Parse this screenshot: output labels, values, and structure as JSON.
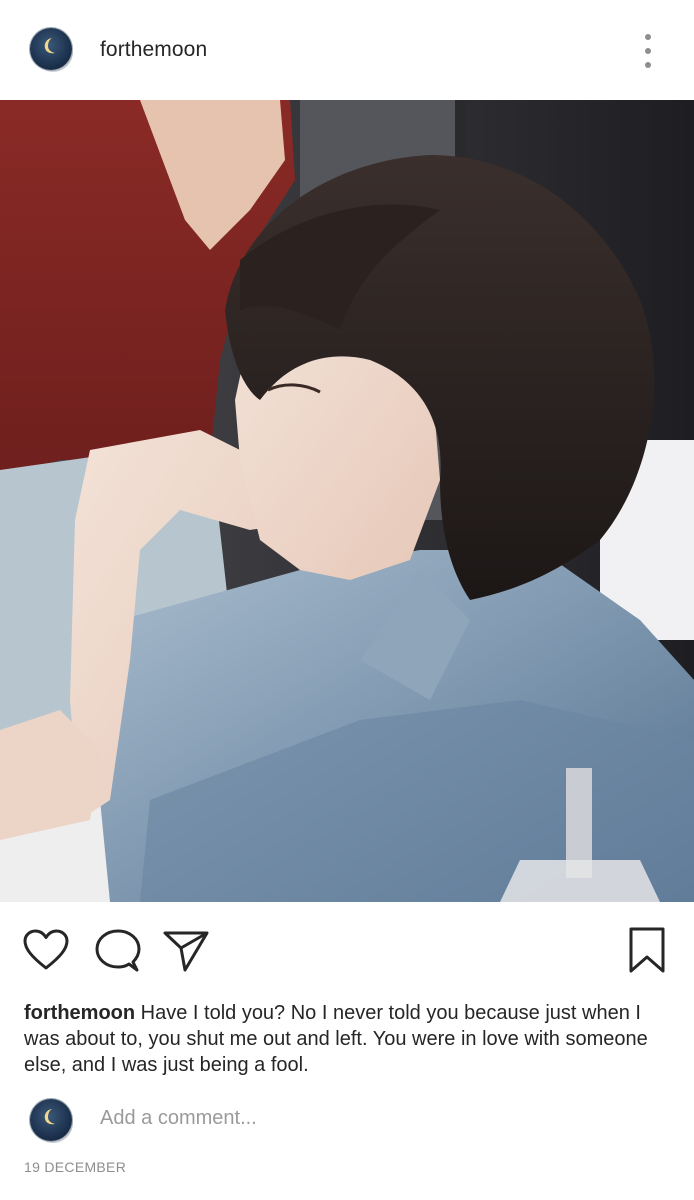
{
  "post": {
    "username": "forthemoon",
    "caption_username": "forthemoon",
    "caption_text": " Have I told you? No I never told you because just when I was about to, you shut me out and left. You were in love with someone else, and I was just being a fool.",
    "comment_placeholder": "Add a comment...",
    "date": "19 DECEMBER"
  },
  "icons": {
    "menu": "more-vertical-icon",
    "like": "heart-icon",
    "comment": "comment-bubble-icon",
    "share": "paper-plane-icon",
    "save": "bookmark-icon"
  },
  "colors": {
    "text": "#262626",
    "muted": "#8e8e8e",
    "avatar_bg": "#1f3552"
  }
}
